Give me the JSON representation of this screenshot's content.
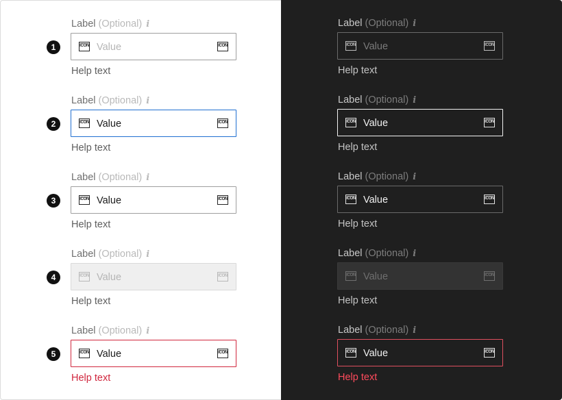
{
  "colors": {
    "focus_border": "#1f6fd1",
    "error": "#d0263d",
    "dark_background": "#1f1f1f"
  },
  "icon_name": "icon-placeholder",
  "icon_text": "ICON",
  "info_glyph": "i",
  "light": [
    {
      "marker": "1",
      "state": "placeholder",
      "label": "Label",
      "optional": "(Optional)",
      "value": "Value",
      "help": "Help text"
    },
    {
      "marker": "2",
      "state": "focused",
      "label": "Label",
      "optional": "(Optional)",
      "value": "Value",
      "help": "Help text"
    },
    {
      "marker": "3",
      "state": "filled",
      "label": "Label",
      "optional": "(Optional)",
      "value": "Value",
      "help": "Help text"
    },
    {
      "marker": "4",
      "state": "disabled",
      "label": "Label",
      "optional": "(Optional)",
      "value": "Value",
      "help": "Help text"
    },
    {
      "marker": "5",
      "state": "error",
      "label": "Label",
      "optional": "(Optional)",
      "value": "Value",
      "help": "Help text"
    }
  ],
  "dark": [
    {
      "state": "placeholder",
      "label": "Label",
      "optional": "(Optional)",
      "value": "Value",
      "help": "Help text"
    },
    {
      "state": "focused",
      "label": "Label",
      "optional": "(Optional)",
      "value": "Value",
      "help": "Help text"
    },
    {
      "state": "filled",
      "label": "Label",
      "optional": "(Optional)",
      "value": "Value",
      "help": "Help text"
    },
    {
      "state": "disabled",
      "label": "Label",
      "optional": "(Optional)",
      "value": "Value",
      "help": "Help text"
    },
    {
      "state": "error",
      "label": "Label",
      "optional": "(Optional)",
      "value": "Value",
      "help": "Help text"
    }
  ]
}
